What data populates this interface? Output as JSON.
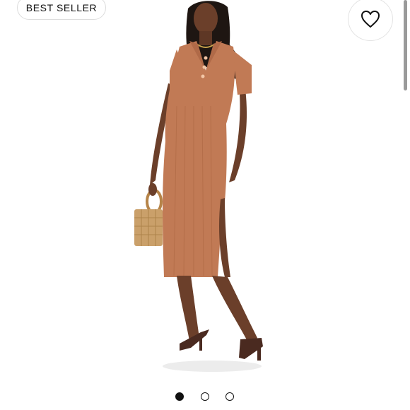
{
  "badge": {
    "label": "BEST SELLER"
  },
  "favorite": {
    "icon": "heart-icon"
  },
  "carousel": {
    "count": 3,
    "active_index": 0
  },
  "colors": {
    "dress": "#c17a55",
    "bag": "#caa06a",
    "skin": "#6b3f2a",
    "sandals": "#4a2a20"
  }
}
